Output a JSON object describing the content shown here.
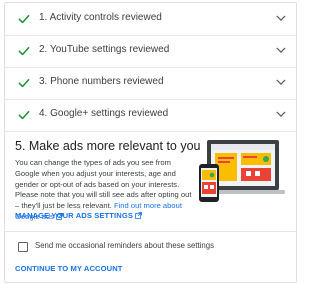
{
  "steps": [
    {
      "label": "1. Activity controls reviewed"
    },
    {
      "label": "2. YouTube settings reviewed"
    },
    {
      "label": "3. Phone numbers reviewed"
    },
    {
      "label": "4. Google+ settings reviewed"
    }
  ],
  "ads_section": {
    "title": "5. Make ads more relevant to you",
    "description": "You can change the types of ads you see from Google when you adjust your interests, age and gender or opt-out of ads based on your interests. Please note that you will still see ads after opting out – they'll just be less relevant.",
    "find_out_more_link": "Find out more about Google ads",
    "manage_link": "MANAGE YOUR ADS SETTINGS"
  },
  "reminder_checkbox": {
    "label": "Send me occasional reminders about these settings",
    "checked": false
  },
  "continue_link": "CONTINUE TO MY ACCOUNT",
  "colors": {
    "check": "#1e8e3e",
    "link": "#1a73e8",
    "text": "#3c4043"
  }
}
